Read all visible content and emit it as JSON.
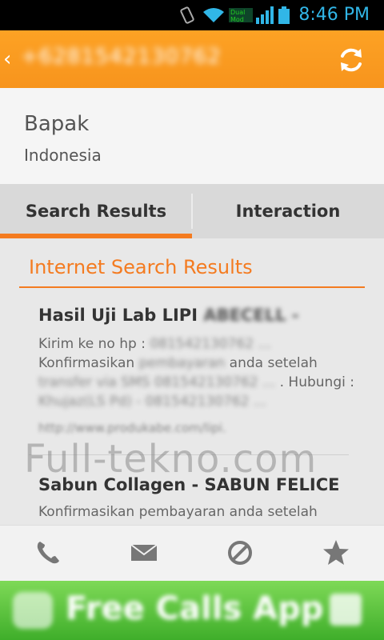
{
  "status_bar": {
    "time": "8:46 PM"
  },
  "app_bar": {
    "phone_number": "+6281542130762"
  },
  "contact": {
    "name": "Bapak",
    "country": "Indonesia"
  },
  "tabs": [
    {
      "label": "Search Results",
      "active": true
    },
    {
      "label": "Interaction",
      "active": false
    }
  ],
  "section": {
    "title": "Internet Search Results"
  },
  "results": [
    {
      "title_visible": "Hasil Uji Lab LIPI",
      "title_blurred": "ABECELL -",
      "line1_visible": "Kirim ke no hp :",
      "line1_blurred": "081542130762 ...",
      "line2_visible": "Konfirmasikan",
      "line2_blurred": "pembayaran",
      "line2_rest": "anda setelah",
      "line3_blurred": "transfer via SMS 081542130762 ...",
      "line3_rest": ". Hubungi :",
      "line4_blurred": "Khujaz(LS Pd) - 081542130762 ...",
      "url": "http://www.produkabe.com/lipi."
    },
    {
      "title": "Sabun Collagen - SABUN FELICE",
      "snippet": "Konfirmasikan pembayaran anda setelah"
    }
  ],
  "watermark": "Full-tekno.com",
  "ad": {
    "text": "Free Calls App"
  },
  "icons": {
    "back": "chevron-left-icon",
    "refresh": "refresh-icon",
    "call": "phone-icon",
    "message": "envelope-icon",
    "block": "block-icon",
    "favorite": "star-icon"
  },
  "colors": {
    "accent": "#f47b20",
    "app_bar": "#f7941d",
    "status_time": "#31b6e7",
    "ad": "#4cbb2f"
  }
}
